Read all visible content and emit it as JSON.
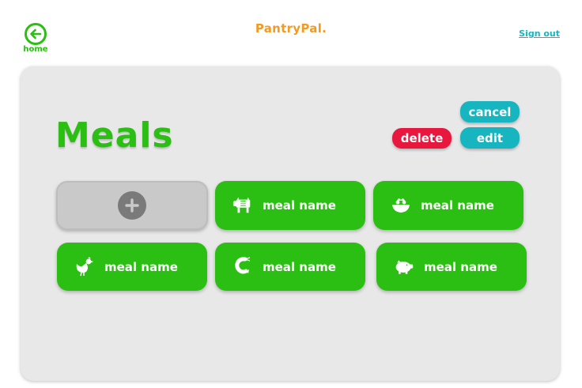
{
  "header": {
    "home_label": "home",
    "brand": "PantryPal.",
    "signout_label": "Sign out"
  },
  "page": {
    "title": "Meals"
  },
  "actions": {
    "cancel_label": "cancel",
    "edit_label": "edit",
    "delete_label": "delete"
  },
  "meals": [
    {
      "label": "meal name",
      "icon": "cow-icon"
    },
    {
      "label": "meal name",
      "icon": "salad-bowl-icon"
    },
    {
      "label": "meal name",
      "icon": "chicken-icon"
    },
    {
      "label": "meal name",
      "icon": "shrimp-icon"
    },
    {
      "label": "meal name",
      "icon": "pig-icon"
    }
  ],
  "colors": {
    "primary_green": "#2bbf13",
    "brand_orange": "#f29a22",
    "accent_teal": "#17b5bf",
    "danger_red": "#e8173d",
    "panel_gray": "#e8e8e9"
  }
}
